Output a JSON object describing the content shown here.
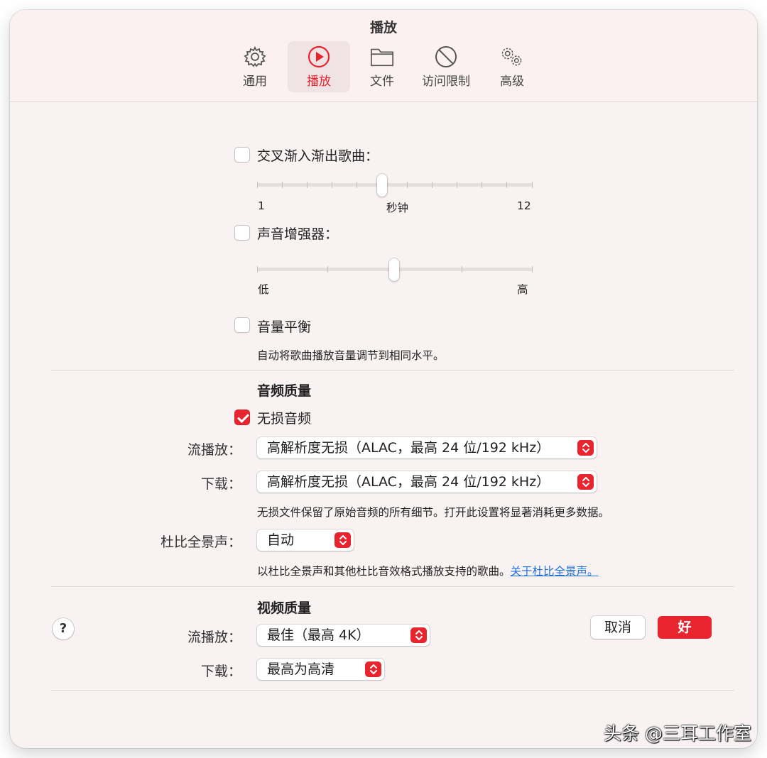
{
  "window": {
    "title": "播放"
  },
  "tabs": [
    {
      "label": "通用",
      "icon": "gear-icon"
    },
    {
      "label": "播放",
      "icon": "play-circle-icon",
      "active": true
    },
    {
      "label": "文件",
      "icon": "folder-icon"
    },
    {
      "label": "访问限制",
      "icon": "prohibited-icon"
    },
    {
      "label": "高级",
      "icon": "gears-icon"
    }
  ],
  "crossfade": {
    "label": "交叉渐入渐出歌曲：",
    "checked": false,
    "min_label": "1",
    "unit_label": "秒钟",
    "max_label": "12",
    "value": 6
  },
  "sound_enhancer": {
    "label": "声音增强器：",
    "checked": false,
    "low_label": "低",
    "high_label": "高",
    "level": 0.5
  },
  "sound_check": {
    "label": "音量平衡",
    "checked": false,
    "description": "自动将歌曲播放音量调节到相同水平。"
  },
  "audio_quality": {
    "heading": "音频质量",
    "lossless": {
      "label": "无损音频",
      "checked": true
    },
    "streaming": {
      "label": "流播放：",
      "value": "高解析度无损（ALAC，最高 24 位/192 kHz）"
    },
    "download": {
      "label": "下载：",
      "value": "高解析度无损（ALAC，最高 24 位/192 kHz）"
    },
    "lossless_note": "无损文件保留了原始音频的所有细节。打开此设置将显著消耗更多数据。",
    "dolby": {
      "label": "杜比全景声：",
      "value": "自动"
    },
    "dolby_note": "以杜比全景声和其他杜比音效格式播放支持的歌曲。",
    "dolby_link": "关于杜比全景声。"
  },
  "video_quality": {
    "heading": "视频质量",
    "streaming": {
      "label": "流播放：",
      "value": "最佳（最高 4K）"
    },
    "download": {
      "label": "下载：",
      "value": "最高为高清"
    }
  },
  "buttons": {
    "help": "?",
    "cancel": "取消",
    "ok": "好"
  },
  "watermark": "头条 @三耳工作室",
  "colors": {
    "accent": "#e8242f",
    "link": "#1f6fd8",
    "background": "#f8f2f2"
  }
}
